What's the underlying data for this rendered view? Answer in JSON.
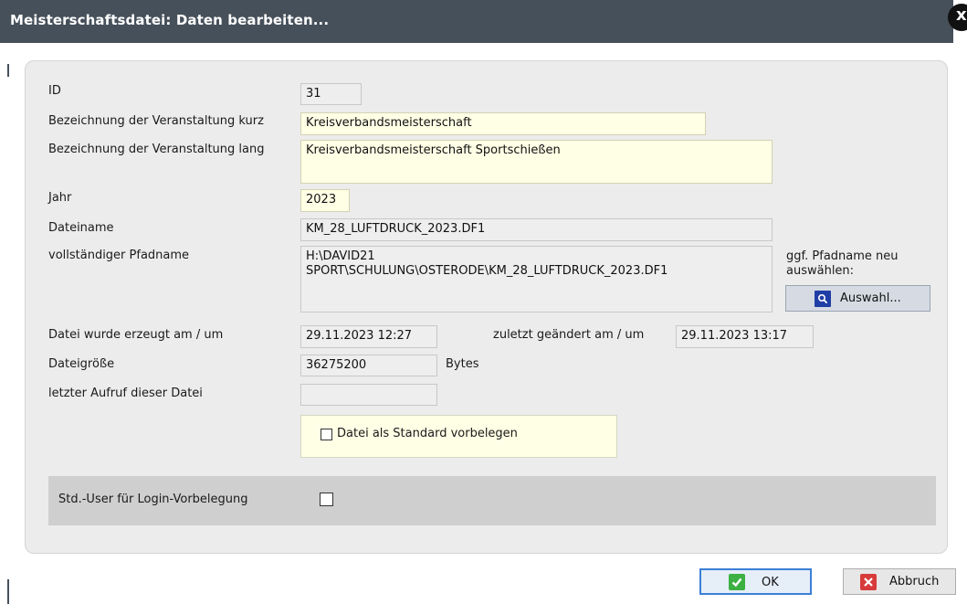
{
  "dialog": {
    "title": "Meisterschaftsdatei: Daten bearbeiten...",
    "close_symbol": "x"
  },
  "fields": {
    "id": {
      "label": "ID",
      "value": "31"
    },
    "short_name": {
      "label": "Bezeichnung der Veranstaltung kurz",
      "value": "Kreisverbandsmeisterschaft"
    },
    "long_name": {
      "label": "Bezeichnung der Veranstaltung lang",
      "value": "Kreisverbandsmeisterschaft Sportschießen"
    },
    "year": {
      "label": "Jahr",
      "value": "2023"
    },
    "filename": {
      "label": "Dateiname",
      "value": "KM_28_LUFTDRUCK_2023.DF1"
    },
    "full_path": {
      "label": "vollständiger Pfadname",
      "value": "H:\\DAVID21\nSPORT\\SCHULUNG\\OSTERODE\\KM_28_LUFTDRUCK_2023.DF1"
    },
    "created": {
      "label": "Datei wurde erzeugt am / um",
      "value": "29.11.2023 12:27"
    },
    "modified": {
      "label": "zuletzt geändert am / um",
      "value": "29.11.2023 13:17"
    },
    "size": {
      "label": "Dateigröße",
      "value": "36275200",
      "unit": "Bytes"
    },
    "last_access": {
      "label": "letzter Aufruf dieser Datei",
      "value": ""
    }
  },
  "path_select": {
    "hint": "ggf. Pfadname neu\nauswählen:",
    "button_label": "Auswahl...",
    "icon": "search-icon"
  },
  "standard": {
    "label": "Datei als Standard vorbelegen",
    "checked": false
  },
  "login": {
    "label": "Std.-User für Login-Vorbelegung",
    "checked": false
  },
  "buttons": {
    "ok": {
      "label": "OK",
      "icon": "check-icon",
      "icon_color": "#3cb043"
    },
    "cancel": {
      "label": "Abbruch",
      "icon": "close-icon",
      "icon_color": "#d83b3b"
    }
  }
}
